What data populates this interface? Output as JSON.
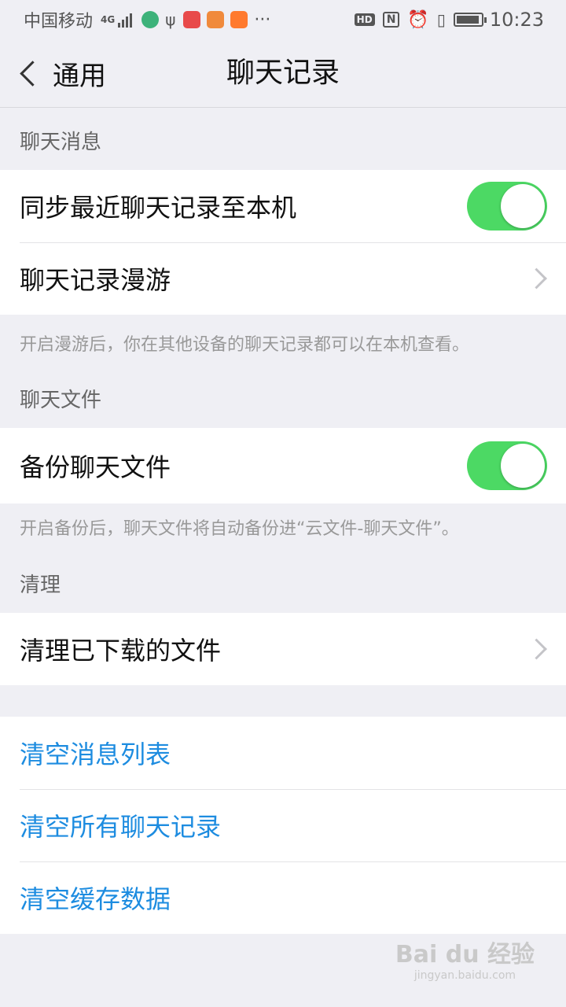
{
  "status_bar": {
    "carrier": "中国移动",
    "network": "4G",
    "time": "10:23",
    "hd": "HD",
    "battery_level": 0.85
  },
  "nav": {
    "back_label": "通用",
    "title": "聊天记录"
  },
  "sections": {
    "chat_messages": {
      "header": "聊天消息",
      "sync_label": "同步最近聊天记录至本机",
      "sync_on": true,
      "roaming_label": "聊天记录漫游",
      "footnote": "开启漫游后，你在其他设备的聊天记录都可以在本机查看。"
    },
    "chat_files": {
      "header": "聊天文件",
      "backup_label": "备份聊天文件",
      "backup_on": true,
      "footnote": "开启备份后，聊天文件将自动备份进“云文件-聊天文件”。"
    },
    "cleanup": {
      "header": "清理",
      "clean_downloads_label": "清理已下载的文件"
    },
    "clear_actions": {
      "clear_message_list": "清空消息列表",
      "clear_all_history": "清空所有聊天记录",
      "clear_cache": "清空缓存数据"
    }
  },
  "watermark": {
    "main": "Bai du 经验",
    "sub": "jingyan.baidu.com"
  },
  "colors": {
    "toggle_on": "#4cd964",
    "link_blue": "#1d8ce0",
    "background": "#efeff4"
  }
}
